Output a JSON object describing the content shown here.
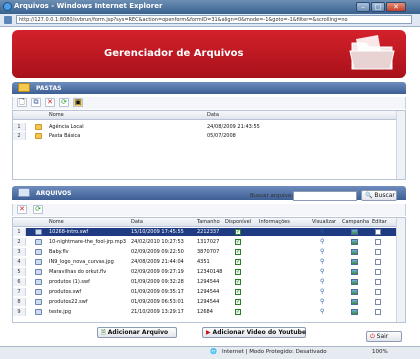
{
  "window": {
    "title": "Arquivos - Windows Internet Explorer",
    "minimize": "–",
    "maximize": "□",
    "close": "✕"
  },
  "address": {
    "url": "http://127.0.0.1:8080/svbrun/form.jsp?sys=REC&action=openform&formID=31&align=0&mode=-1&goto=-1&filter=&scrolling=no"
  },
  "banner": {
    "title": "Gerenciador de Arquivos"
  },
  "pastas": {
    "section_label": "PASTAS",
    "columns": {
      "nome": "Nome",
      "data": "Data"
    },
    "rows": [
      {
        "num": "1",
        "nome": "Agência Local",
        "data": "24/08/2009 21:43:55"
      },
      {
        "num": "2",
        "nome": "Pasta Básica",
        "data": "05/07/2008"
      }
    ]
  },
  "arquivos": {
    "section_label": "ARQUIVOS",
    "search_label": "Buscar arquivo:",
    "search_value": "",
    "search_button": "Buscar",
    "columns": {
      "nome": "Nome",
      "data": "Data",
      "tamanho": "Tamanho",
      "disponivel": "Disponível",
      "informacoes": "Informações",
      "visualizar": "Visualizar",
      "campanha": "Campanha",
      "editar": "Editar"
    },
    "rows": [
      {
        "num": "1",
        "nome": "10268-intro.swf",
        "data": "15/10/2009 17:45:55",
        "tamanho": "2212337",
        "selected": true
      },
      {
        "num": "2",
        "nome": "10-nightmare-the_fool-jrp.mp3",
        "data": "24/02/2010 10:27:53",
        "tamanho": "1317027"
      },
      {
        "num": "3",
        "nome": "Baby.flv",
        "data": "02/09/2009 09:22:50",
        "tamanho": "3870707"
      },
      {
        "num": "4",
        "nome": "IN9_logo_nova_curvas.jpg",
        "data": "24/08/2009 21:44:04",
        "tamanho": "4351"
      },
      {
        "num": "5",
        "nome": "Maravilhas do orkut.flv",
        "data": "02/09/2009 09:27:19",
        "tamanho": "12340148"
      },
      {
        "num": "6",
        "nome": "produtos (1).swf",
        "data": "01/09/2009 09:32:28",
        "tamanho": "1294544"
      },
      {
        "num": "7",
        "nome": "produtos.swf",
        "data": "01/09/2009 09:35:17",
        "tamanho": "1294544"
      },
      {
        "num": "8",
        "nome": "produtos22.swf",
        "data": "01/09/2009 06:53:01",
        "tamanho": "1294544"
      },
      {
        "num": "9",
        "nome": "teste.jpg",
        "data": "21/10/2009 13:29:17",
        "tamanho": "12684"
      }
    ]
  },
  "buttons": {
    "adicionar_arquivo": "Adicionar Arquivo",
    "adicionar_video": "Adicionar Video do Youtube",
    "sair": "Sair"
  },
  "statusbar": {
    "zone": "Internet | Modo Protegido: Desativado",
    "zoom": "100%"
  },
  "colors": {
    "banner": "#c8161f",
    "section_header": "#4d6ea3",
    "selected_row": "#1f3c82"
  }
}
